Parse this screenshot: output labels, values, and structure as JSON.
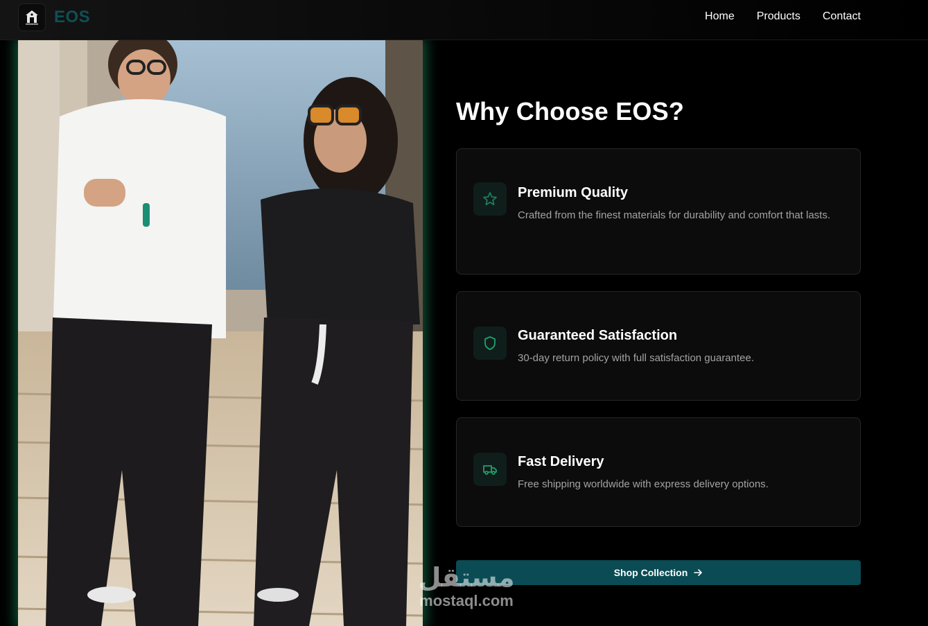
{
  "nav": {
    "brand": "EOS",
    "links": [
      "Home",
      "Products",
      "Contact"
    ]
  },
  "main": {
    "heading": "Why Choose EOS?",
    "features": [
      {
        "title": "Premium Quality",
        "desc": "Crafted from the finest materials for durability and comfort that lasts.",
        "icon": "star-icon"
      },
      {
        "title": "Guaranteed Satisfaction",
        "desc": "30-day return policy with full satisfaction guarantee.",
        "icon": "shield-icon"
      },
      {
        "title": "Fast Delivery",
        "desc": "Free shipping worldwide with express delivery options.",
        "icon": "truck-icon"
      }
    ],
    "cta_label": "Shop Collection"
  },
  "watermark": {
    "arabic": "مستقل",
    "latin": "mostaql.com"
  },
  "colors": {
    "accent": "#0b4b54",
    "brand": "#0f4f55",
    "icon_green": "#22a06b",
    "glow": "#1ea06e"
  }
}
